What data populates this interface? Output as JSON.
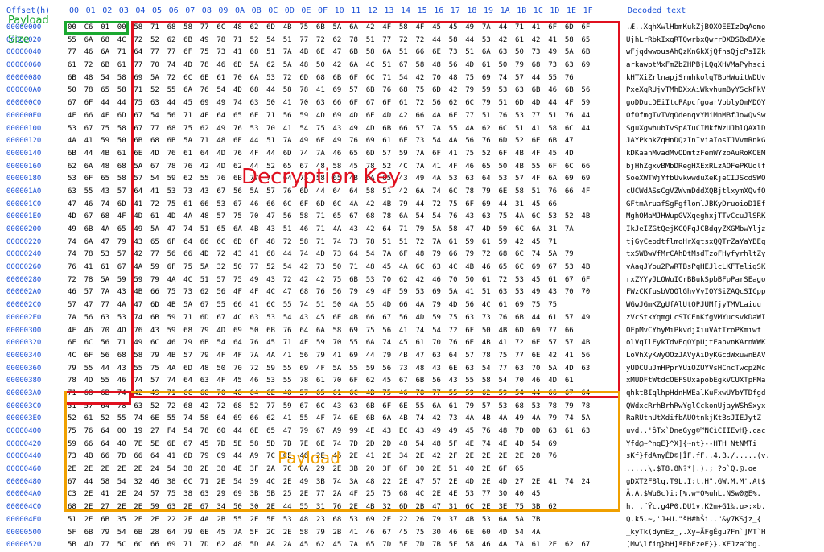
{
  "header": {
    "offset_label": "Offset(h)",
    "columns": [
      "00",
      "01",
      "02",
      "03",
      "04",
      "05",
      "06",
      "07",
      "08",
      "09",
      "0A",
      "0B",
      "0C",
      "0D",
      "0E",
      "0F",
      "10",
      "11",
      "12",
      "13",
      "14",
      "15",
      "16",
      "17",
      "18",
      "19",
      "1A",
      "1B",
      "1C",
      "1D",
      "1E",
      "1F"
    ],
    "decoded_label": "Decoded text"
  },
  "annotations": {
    "payload_size_1": "Payload",
    "payload_size_2": "Size",
    "decryption_key": "Decryption Key",
    "payload": "Payload"
  },
  "rows": [
    {
      "offset": "00000000",
      "hex": "00 C6 01 00 58 71 68 58 77 6C 48 62 6D 4B 75 6B 5A 6A 42 4F 58 4F 45 45 49 7A 44 71 41 6F 6D 6F",
      "text": ".Æ..XqhXwlHbmKukZjBOXOEEIzDqAomo"
    },
    {
      "offset": "00000020",
      "hex": "55 6A 68 4C 72 52 62 6B 49 78 71 52 54 51 77 72 62 78 51 77 72 72 44 58 44 53 42 61 42 41 58 65",
      "text": "UjhLrRbkIxqRTQwrbxQwrrDXDSBxBAXe"
    },
    {
      "offset": "00000040",
      "hex": "77 46 6A 71 64 77 77 6F 75 73 41 68 51 7A 4B 6E 47 6B 58 6A 51 66 6E 73 51 6A 63 50 73 49 5A 6B",
      "text": "wFjqdwwousAhQzKnGkXjQfnsQjcPsIZk"
    },
    {
      "offset": "00000060",
      "hex": "61 72 6B 61 77 70 74 4D 78 46 6D 5A 62 5A 48 50 42 6A 4C 51 67 58 48 56 4D 61 50 79 68 73 63 69",
      "text": "arkawptMxFmZbZHPBjLQgXHVMaPyhsci"
    },
    {
      "offset": "00000080",
      "hex": "6B 48 54 58 69 5A 72 6C 6E 61 70 6A 53 72 6D 68 6B 6F 6C 71 54 42 70 48 75 69 74 57 44 55 76",
      "text": "kHTXiZrlnapjSrmhkolqTBpHWuitWDUv"
    },
    {
      "offset": "000000A0",
      "hex": "50 78 65 58 71 52 55 6A 76 54 4D 68 44 58 78 41 69 57 6B 76 68 75 6D 42 79 59 53 63 6B 46 6B 56",
      "text": "PxeXqRUjvTMhDXxAiWkvhumByYSckFkV"
    },
    {
      "offset": "000000C0",
      "hex": "67 6F 44 44 75 63 44 45 69 49 74 63 50 41 70 63 66 6F 67 6F 61 72 56 62 6C 79 51 6D 4D 44 4F 59",
      "text": "goDDucDEiItcPApcfgoarVbblyQmMDOY"
    },
    {
      "offset": "000000E0",
      "hex": "4F 66 4F 6D 67 54 56 71 4F 64 65 6E 71 56 59 4D 69 4D 6E 4D 42 66 4A 6F 77 51 76 53 77 51 76 44",
      "text": "OfOfmgTvTVqOdenqvYMiMnMBfJowQvSw"
    },
    {
      "offset": "00000100",
      "hex": "53 67 75 58 67 77 68 75 62 49 76 53 70 41 54 75 43 49 4D 6B 66 57 7A 55 4A 62 6C 51 41 58 6C 44",
      "text": "SguXgwhubIvSpATuCIMkfWzUJblQAXlD"
    },
    {
      "offset": "00000120",
      "hex": "4A 41 59 50 6B 68 6B 5A 71 48 6E 44 51 7A 49 6E 49 76 69 61 6F 73 54 4A 56 76 6D 52 6E 6B 47",
      "text": "JAYPkhkZqHnDQzInIviaIosTJVvmRnkG"
    },
    {
      "offset": "00000140",
      "hex": "6B 44 4B 61 6E 4D 76 61 64 4D 76 4F 44 6D 74 7A 46 65 6D 57 59 7A 6F 41 75 52 6F 4B 4F 45 4D",
      "text": "kDKaanMvadMvODmtzFemWYzoAuRoKOEM"
    },
    {
      "offset": "00000160",
      "hex": "62 6A 48 68 5A 67 78 76 42 4D 62 44 52 65 67 48 58 45 78 52 4C 7A 41 4F 46 65 50 4B 55 6F 6C 66",
      "text": "bjHhZgxvBMbDRegHXExRLzAOFePKUolf"
    },
    {
      "offset": "00000180",
      "hex": "53 6F 65 58 57 54 59 62 55 76 6B 77 77 64 75 58 65 4B 6A 65 43 49 4A 53 63 64 53 57 4F 6A 69 69",
      "text": "SoeXWTWjYfbUvkwwduXeKjeCIJScdSWO"
    },
    {
      "offset": "000001A0",
      "hex": "63 55 43 57 64 41 53 73 43 67 56 5A 57 76 6D 44 64 64 58 51 42 6A 74 6C 78 79 6E 58 51 76 66 4F",
      "text": "cUCWdASsCgVZWvmDddXQBjtlxymXQvfO"
    },
    {
      "offset": "000001C0",
      "hex": "47 46 74 6D 41 72 75 61 66 53 67 46 66 6C 6F 6D 6C 4A 42 4B 79 44 72 75 6F 69 44 31 45 66",
      "text": "GFtmAruafSgFgflomlJBKyDruoioD1Ef"
    },
    {
      "offset": "000001E0",
      "hex": "4D 67 68 4F 4D 61 4D 4A 48 57 75 70 47 56 58 71 65 67 68 78 6A 54 54 76 43 63 75 4A 6C 53 52 4B",
      "text": "MghOMaMJHWupGVXqeghxjTTvCcuJlSRK"
    },
    {
      "offset": "00000200",
      "hex": "49 6B 4A 65 49 5A 47 74 51 65 6A 4B 43 51 46 71 4A 43 42 64 71 79 5A 58 47 4D 59 6C 6A 31 7A",
      "text": "IkJeIZGtQejKCQFqJCBdqyZXGMbwYljz"
    },
    {
      "offset": "00000220",
      "hex": "74 6A 47 79 43 65 6F 64 66 6C 6D 6F 48 72 58 71 74 73 78 51 51 72 7A 61 59 61 59 42 45 71",
      "text": "tjGyCeodtflmoHrXqtsxQQTrZaYaYBEq"
    },
    {
      "offset": "00000240",
      "hex": "74 78 53 57 42 77 56 66 4D 72 43 41 68 44 74 4D 73 64 54 7A 6F 48 79 66 79 72 68 6C 74 5A 79",
      "text": "txSWBwVfMrCAhDtMsdTzoFHyfyrhltZy"
    },
    {
      "offset": "00000260",
      "hex": "76 41 61 67 4A 59 6F 75 5A 32 50 77 52 54 42 73 50 71 48 45 4A 6C 63 4C 4B 46 65 6C 69 67 53 4B",
      "text": "vAagJYou2PwRTBsPqHEJlcLKFTeligSK"
    },
    {
      "offset": "00000280",
      "hex": "72 78 5A 59 59 79 4A 4C 51 57 75 49 43 72 42 42 75 6B 53 70 62 42 46 70 50 61 72 53 45 61 67 6F",
      "text": "rxZYYyJLQWuICrBBukSpbBFpParSEago"
    },
    {
      "offset": "000002A0",
      "hex": "46 57 7A 43 4B 66 75 73 62 56 4F 4F 4C 47 68 76 56 79 49 4F 59 53 69 5A 41 51 63 53 49 43 70 70",
      "text": "FWzCKfusbVOOlGhvVyIOYSiZAQcSICpp"
    },
    {
      "offset": "000002C0",
      "hex": "57 47 77 4A 47 6D 4B 5A 67 55 66 41 6C 55 74 51 50 4A 55 4D 66 4A 79 4D 56 4C 61 69 75 75",
      "text": "WGwJGmKZgUfAlUtQPJUMfjyTMVLaiuu"
    },
    {
      "offset": "000002E0",
      "hex": "7A 56 63 53 74 6B 59 71 6D 67 4C 63 53 54 43 45 6E 4B 66 67 56 4D 59 75 63 73 76 6B 44 61 57 49",
      "text": "zVcStkYqmgLcSTCEnKfgVMYucsvkDaWI"
    },
    {
      "offset": "00000300",
      "hex": "4F 46 70 4D 76 43 59 68 79 4D 69 50 6B 76 64 6A 58 69 75 56 41 74 54 72 6F 50 4B 6D 69 77 66",
      "text": "OFpMvCYhyMiPkvdjXiuVAtTroPKmiwf"
    },
    {
      "offset": "00000320",
      "hex": "6F 6C 56 71 49 6C 46 79 6B 54 64 76 45 71 4F 59 70 55 6A 74 45 61 70 76 6E 4B 41 72 6E 57 57 4B",
      "text": "olVqIlFykTdvEqOYpUjtEapvnKArnWWK"
    },
    {
      "offset": "00000340",
      "hex": "4C 6F 56 68 58 79 4B 57 79 4F 4F 7A 4A 41 56 79 41 69 44 79 4B 47 63 64 57 78 75 77 6E 42 41 56",
      "text": "LoVhXyKWyOOzJAVyAiDyKGcdWxuwnBAV"
    },
    {
      "offset": "00000360",
      "hex": "79 55 44 43 55 75 4A 6D 48 50 70 72 59 55 69 4F 5A 55 59 56 73 48 43 6E 63 54 77 63 70 5A 4D 63",
      "text": "yUDCUuJmHPprYUiOZUYVsHCncTwcpZMc"
    },
    {
      "offset": "00000380",
      "hex": "78 4D 55 46 74 57 74 64 63 4F 45 46 53 55 78 61 70 6F 62 45 67 6B 56 43 55 58 54 70 46 4D 61",
      "text": "xMUDFtWtdcOEFSUxapobEgkVCUXTpFMa"
    },
    {
      "offset": "000003A0",
      "hex": "71 68 6B 74 42 49 71 6C 68 70 48 64 6E 48 57 65 61 6C 4B 75 46 78 77 55 59 62 59 54 44 66 67 64",
      "text": "qhktBIqlhpHdnHWEalKuFxwUYbYTDfgd"
    },
    {
      "offset": "000003C0",
      "hex": "51 57 64 78 63 52 72 68 42 72 68 52 77 59 67 6C 43 63 6B 6F 6E 55 6A 61 79 57 53 68 53 78 79 78",
      "text": "QWdxcRrhBrhRwYglCckonUjayWShSxyx"
    },
    {
      "offset": "000003E0",
      "hex": "52 61 52 55 74 6E 55 74 58 64 69 66 62 41 55 4F 74 6E 6B 6A 4B 74 42 73 4A 4B 4A 49 4A 79 74 5A",
      "text": "RaRUtnUtXdifbAUOtnkjKtBsJIEJytZ"
    },
    {
      "offset": "00000400",
      "hex": "75 76 64 00 19 27 F4 54 78 60 44 6E 65 47 79 67 A9 99 4E 43 EC 43 49 49 45 76 48 7D 0D 63 61 63",
      "text": "uvd..'ôTx`DneGyg©™NCìCIIEvH}.cac"
    },
    {
      "offset": "00000420",
      "hex": "59 66 64 40 7E 5E 6E 67 45 7D 5E 58 5D 7B 7E 6E 74 7D 2D 2D 48 54 48 5F 4E 74 4E 4D 54 69",
      "text": "Yfd@~^ngE}^X]{~nt}--HTH_NtNMTi"
    },
    {
      "offset": "00000440",
      "hex": "73 4B 66 7D 66 64 41 6D 79 C9 44 A9 7C CE 46 2E 46 2E 41 2E 34 2E 42 2F 2E 2E 2E 2E 28 76",
      "text": "sKf}fdAmyÉD©|ÎF.fF..4.B./.....(v."
    },
    {
      "offset": "00000460",
      "hex": "2E 2E 2E 2E 2E 24 54 38 2E 38 4E 3F 2A 7C 0A 29 2E 3B 20 3F 6F 30 2E 51 40 2E 6F 65",
      "text": ".....\\.$T8.8N?*|.).; ?o`Q.@.oe"
    },
    {
      "offset": "00000480",
      "hex": "67 44 58 54 32 46 38 6C 71 2E 54 39 4C 2E 49 3B 74 3A 48 22 2E 47 57 2E 4D 2E 4D 27 2E 41 74 24",
      "text": "gDXT2F8lq.T9L.I;t.H\".GW.M.M'.At$"
    },
    {
      "offset": "000004A0",
      "hex": "C3 2E 41 2E 24 57 75 38 63 29 69 3B 5B 25 2E 77 2A 4F 25 75 68 4C 2E 4E 53 77 30 40 45",
      "text": "Ã.A.$Wu8c)i;[%.w*O%uhL.NSw0@E%."
    },
    {
      "offset": "000004C0",
      "hex": "68 2E 27 2E 2E 59 63 2E 67 34 50 30 2E 44 55 31 76 2E 4B 32 6D 2B 47 31 6C 2E 3E 75 3B 62",
      "text": "h.'.¨Ÿc.g4P0.DU1v.K2m+G1‰.u>;»b."
    },
    {
      "offset": "000004E0",
      "hex": "51 2E 6B 35 2E 2E 22 2F 4A 2B 55 2E 5E 53 48 23 68 53 69 2E 22 26 79 37 4B 53 6A 5A 7B",
      "text": "Q.k5.~,'J+U.\"šH#hŠi..\"&y7KSjz_{"
    },
    {
      "offset": "00000500",
      "hex": "5F 6B 79 54 6B 28 64 79 6E 45 7A 5F 2C 2E 58 79 2B 41 46 67 45 75 30 46 6E 60 4D 54 4A",
      "text": "_kyTk(dynEz_,.Xy+ÃFgÊgü?Fn`]MT`H"
    },
    {
      "offset": "00000520",
      "hex": "5B 4D 77 5C 6C 66 69 71 7D 62 48 5D AA 2A 45 62 45 7A 65 7D 5F 7D 7B 5F 58 46 4A 7A 61 2E 62 67",
      "text": "[Mw\\lfiq}bH]ªEbEzeE}}.XFJza^bg."
    }
  ]
}
